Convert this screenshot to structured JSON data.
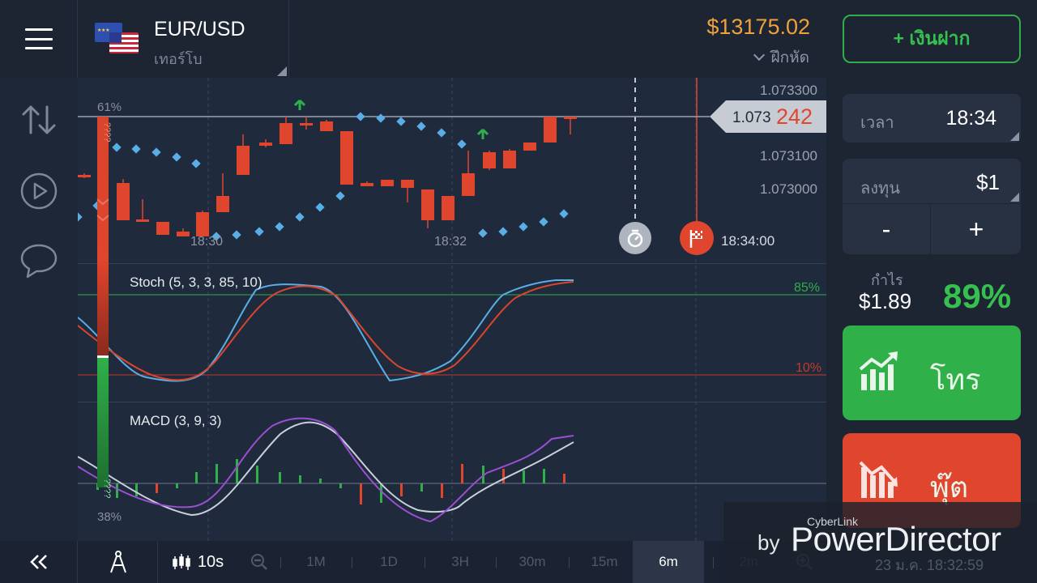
{
  "header": {
    "asset_name": "EUR/USD",
    "asset_type": "เทอร์โบ",
    "balance": "$13175.02",
    "withdraw_label": "ฝึกหัด",
    "deposit_label": "+ เงินฝาก"
  },
  "chart": {
    "current_price_prefix": "1.073",
    "current_price_suffix": "242",
    "price_ticks": [
      "1.073300",
      "1.073100",
      "1.073000"
    ],
    "time_ticks": [
      "18:30",
      "18:32"
    ],
    "expiry_time": "18:34:00",
    "upper_pct": "61%",
    "lower_pct": "38%",
    "vbar_upper": "????",
    "vbar_lower": "????",
    "stoch_label": "Stoch (5, 3, 3, 85, 10)",
    "stoch_upper": "85%",
    "stoch_lower": "10%",
    "macd_label": "MACD (3, 9, 3)"
  },
  "panel": {
    "time_label": "เวลา",
    "time_value": "18:34",
    "invest_label": "ลงทุน",
    "invest_value": "$1",
    "minus": "-",
    "plus": "+",
    "profit_label": "กำไร",
    "profit_amount": "$1.89",
    "profit_pct": "89%",
    "call_label": "โทร",
    "put_label": "พุ๊ต"
  },
  "toolbar": {
    "interval": "10s",
    "timeframes": [
      "1M",
      "1D",
      "3H",
      "30m",
      "15m",
      "6m",
      "2m"
    ],
    "active_timeframe": "6m"
  },
  "watermark": {
    "cyberlink": "CyberLink",
    "by": "by",
    "powerdirector": "PowerDirector",
    "datetime": "23 ม.ค. 18:32:59"
  },
  "colors": {
    "up": "#2fb049",
    "down": "#e0452d",
    "balance": "#f0a23a",
    "stoch_fast": "#5aaee6",
    "stoch_slow": "#d9452d",
    "macd_signal": "#c8d0da",
    "macd_line": "#9b4fd1"
  },
  "icons": {
    "menu": "hamburger-menu-icon",
    "trades": "up-down-arrows-icon",
    "video": "play-circle-icon",
    "chat": "chat-bubble-icon",
    "chart_type": "candlestick-icon",
    "drawing": "compass-icon",
    "zoom_out": "zoom-out-icon",
    "zoom_in": "zoom-in-icon",
    "collapse": "double-chevron-left-icon"
  }
}
